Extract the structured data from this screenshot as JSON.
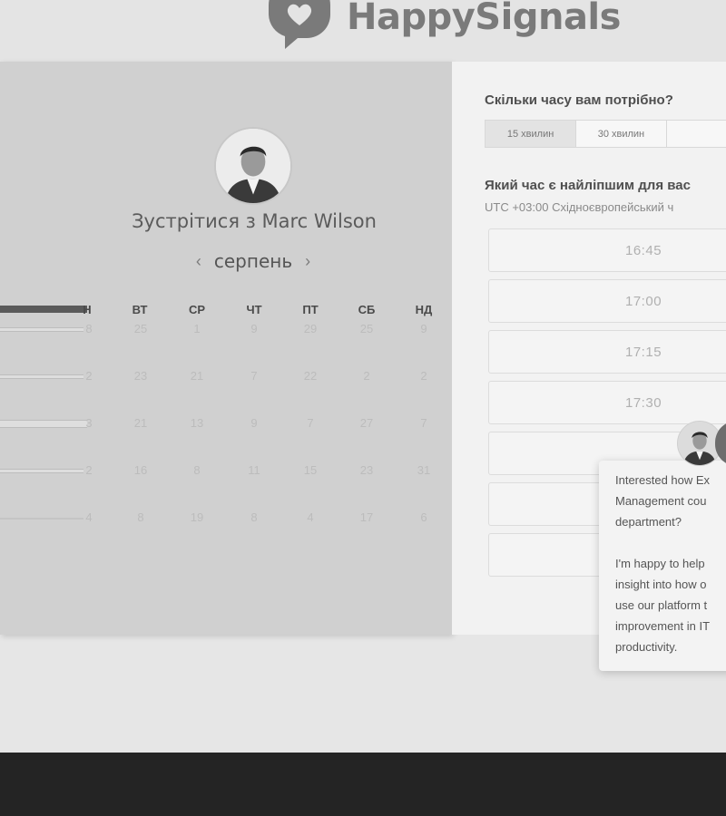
{
  "brand": {
    "name": "HappySignals"
  },
  "booking": {
    "title": "Зустрітися з Marc Wilson",
    "month": "серпень",
    "weekdays": [
      "Н",
      "ВТ",
      "СР",
      "ЧТ",
      "ПТ",
      "СБ",
      "НД"
    ],
    "weeks": [
      [
        "8",
        "25",
        "1",
        "9",
        "29",
        "25",
        "9"
      ],
      [
        "2",
        "23",
        "21",
        "7",
        "22",
        "2",
        "2"
      ],
      [
        "3",
        "21",
        "13",
        "9",
        "7",
        "27",
        "7"
      ],
      [
        "2",
        "16",
        "8",
        "11",
        "15",
        "23",
        "31"
      ],
      [
        "4",
        "8",
        "19",
        "8",
        "4",
        "17",
        "6"
      ]
    ]
  },
  "scheduler": {
    "duration_question": "Скільки часу вам потрібно?",
    "durations": [
      "15 хвилин",
      "30 хвилин",
      ""
    ],
    "time_question": "Який час є найліпшим для вас",
    "timezone": "UTC +03:00 Східноєвропейський ч",
    "slots": [
      "16:45",
      "17:00",
      "17:15",
      "17:30",
      "",
      "",
      ""
    ]
  },
  "chat": {
    "lines": [
      "Interested how Ex",
      "Management cou",
      "department?",
      "",
      "I'm happy to help",
      "insight into how o",
      "use our platform t",
      "improvement in IT",
      "productivity."
    ]
  },
  "icons": {
    "logo": "heart-speech-bubble-icon",
    "prev": "chevron-left-icon",
    "next": "chevron-right-icon"
  }
}
